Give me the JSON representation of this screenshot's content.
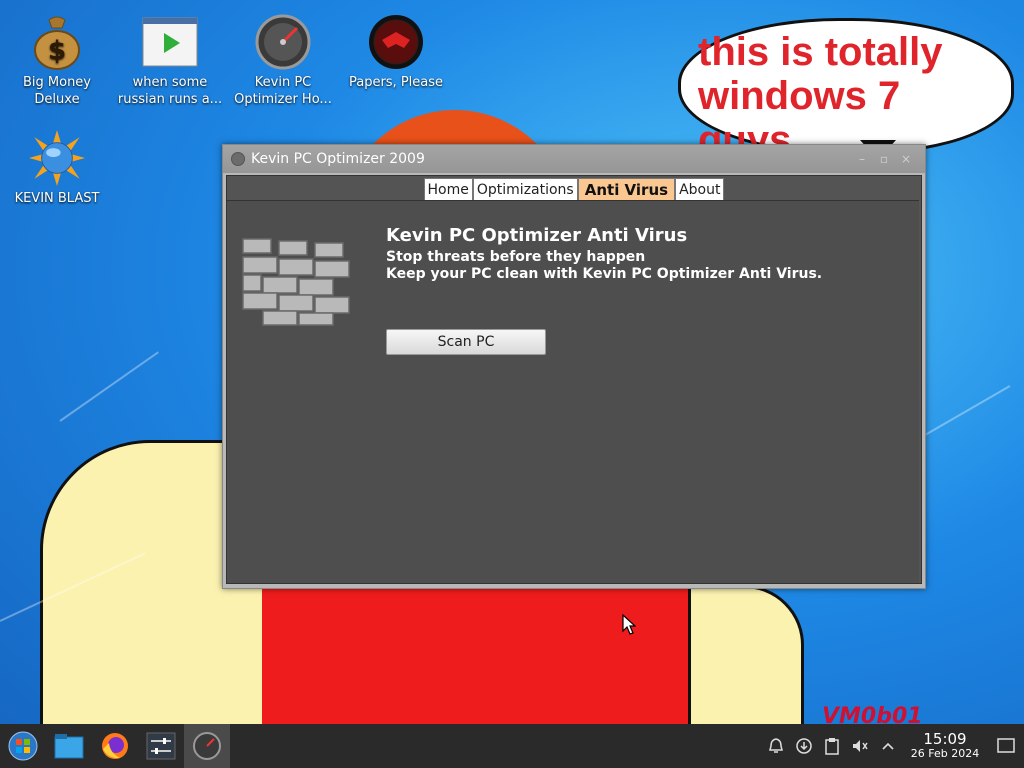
{
  "desktop": {
    "icons": [
      {
        "label": "Big Money\nDeluxe"
      },
      {
        "label": "when some\nrussian runs a..."
      },
      {
        "label": "Kevin PC\nOptimizer Ho..."
      },
      {
        "label": "Papers, Please"
      },
      {
        "label": "KEVIN BLAST"
      }
    ],
    "speech_bubble": "this is totally windows 7 guys",
    "watermark": "VM0b01"
  },
  "window": {
    "title": "Kevin PC Optimizer 2009",
    "buttons": {
      "minimize": "–",
      "maximize": "▫",
      "close": "×"
    },
    "tabs": [
      {
        "label": "Home",
        "active": false
      },
      {
        "label": "Optimizations",
        "active": false
      },
      {
        "label": "Anti Virus",
        "active": true
      },
      {
        "label": "About",
        "active": false
      }
    ],
    "panel": {
      "title": "Kevin PC Optimizer Anti Virus",
      "subtitle1": "Stop threats before they happen",
      "subtitle2": "Keep your PC clean with Kevin PC Optimizer Anti Virus.",
      "scan_button": "Scan PC"
    }
  },
  "taskbar": {
    "items": [
      "start-menu",
      "file-manager",
      "firefox",
      "system-settings",
      "kevin-pc-optimizer"
    ],
    "clock": {
      "time": "15:09",
      "date": "26 Feb 2024"
    }
  }
}
